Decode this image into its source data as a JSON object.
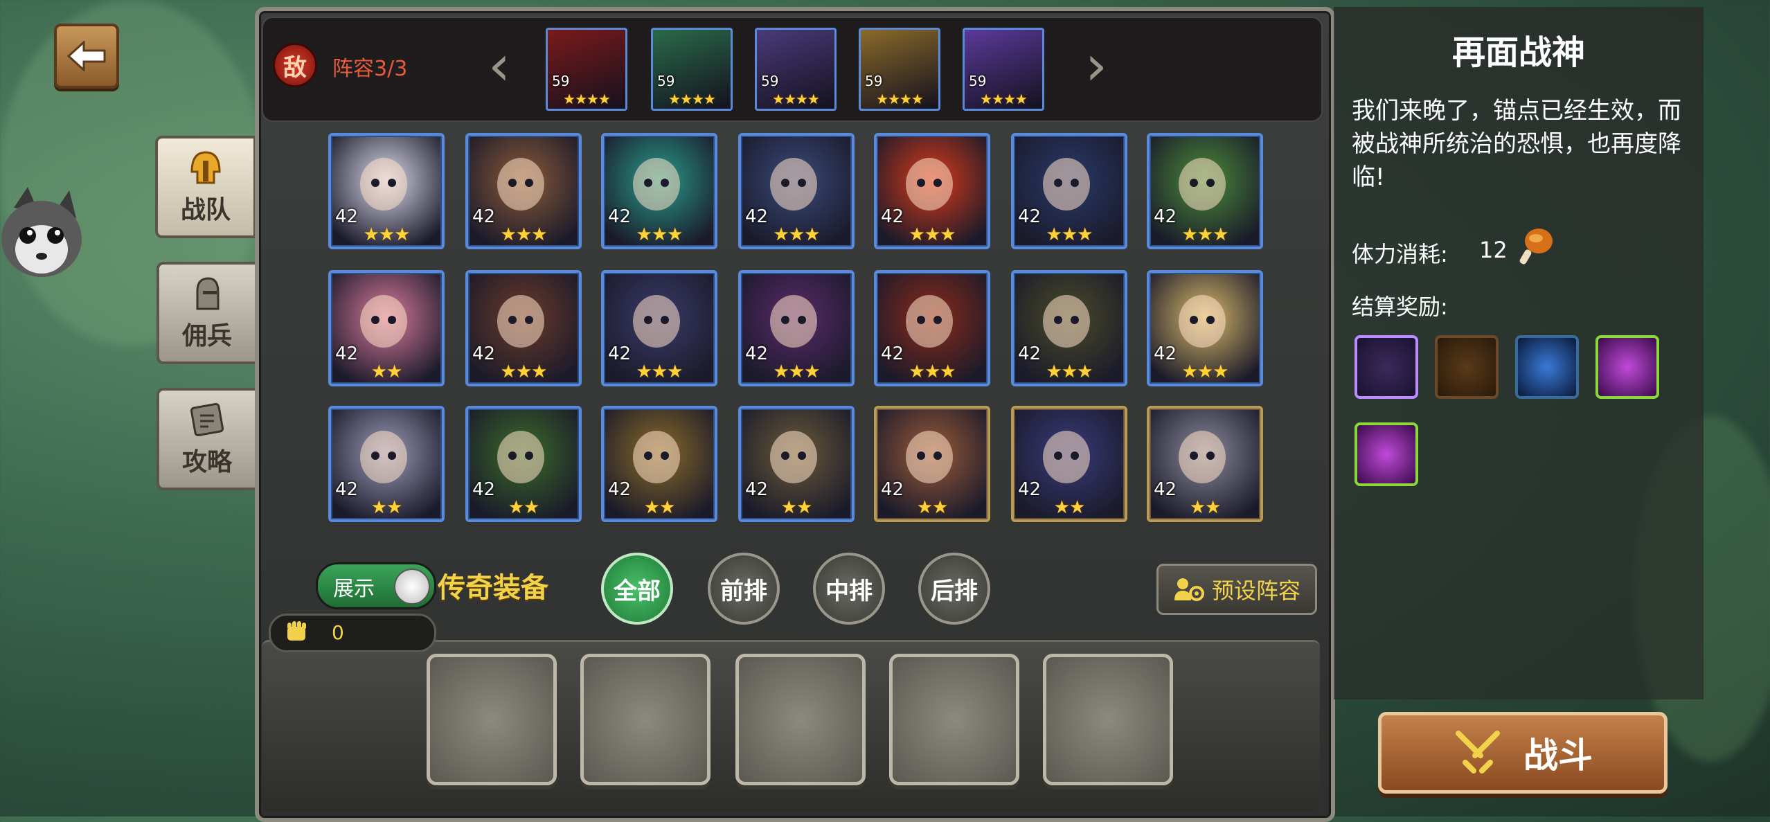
{
  "left": {
    "back_icon": "arrow-left-icon",
    "tabs": [
      {
        "label": "战队",
        "icon": "helmet-icon",
        "active": true
      },
      {
        "label": "佣兵",
        "icon": "knight-helmet-icon",
        "active": false
      },
      {
        "label": "攻略",
        "icon": "scroll-icon",
        "active": false
      }
    ]
  },
  "enemy": {
    "badge": "敌",
    "lineup_label": "阵容3/3",
    "heroes": [
      {
        "level": "59",
        "stars": "★★★★",
        "color": "#7a1a1a"
      },
      {
        "level": "59",
        "stars": "★★★★",
        "color": "#2a6a4a"
      },
      {
        "level": "59",
        "stars": "★★★★",
        "color": "#4a3a7a"
      },
      {
        "level": "59",
        "stars": "★★★★",
        "color": "#8a6a2a"
      },
      {
        "level": "59",
        "stars": "★★★★",
        "color": "#5a3a9a"
      }
    ]
  },
  "heroes": [
    {
      "level": "42",
      "stars": "★★★",
      "color": "#d8d8e8",
      "frame": "blue"
    },
    {
      "level": "42",
      "stars": "★★★",
      "color": "#8a5a3a",
      "frame": "blue"
    },
    {
      "level": "42",
      "stars": "★★★",
      "color": "#2a9a8a",
      "frame": "blue"
    },
    {
      "level": "42",
      "stars": "★★★",
      "color": "#3a4a7a",
      "frame": "blue"
    },
    {
      "level": "42",
      "stars": "★★★",
      "color": "#d83a1a",
      "frame": "blue"
    },
    {
      "level": "42",
      "stars": "★★★",
      "color": "#2a3a6a",
      "frame": "blue"
    },
    {
      "level": "42",
      "stars": "★★★",
      "color": "#4a8a3a",
      "frame": "blue"
    },
    {
      "level": "42",
      "stars": "★★",
      "color": "#d87a9a",
      "frame": "blue"
    },
    {
      "level": "42",
      "stars": "★★★",
      "color": "#6a3a2a",
      "frame": "blue"
    },
    {
      "level": "42",
      "stars": "★★★",
      "color": "#3a3a6a",
      "frame": "blue"
    },
    {
      "level": "42",
      "stars": "★★★",
      "color": "#5a2a6a",
      "frame": "blue"
    },
    {
      "level": "42",
      "stars": "★★★",
      "color": "#8a2a1a",
      "frame": "blue"
    },
    {
      "level": "42",
      "stars": "★★★",
      "color": "#4a4a2a",
      "frame": "blue"
    },
    {
      "level": "42",
      "stars": "★★★",
      "color": "#d8b86a",
      "frame": "blue"
    },
    {
      "level": "42",
      "stars": "★★",
      "color": "#9a9ab8",
      "frame": "blue"
    },
    {
      "level": "42",
      "stars": "★★",
      "color": "#3a6a2a",
      "frame": "blue"
    },
    {
      "level": "42",
      "stars": "★★",
      "color": "#8a6a2a",
      "frame": "blue"
    },
    {
      "level": "42",
      "stars": "★★",
      "color": "#6a5a3a",
      "frame": "blue"
    },
    {
      "level": "42",
      "stars": "★★",
      "color": "#9a5a3a",
      "frame": "gold"
    },
    {
      "level": "42",
      "stars": "★★",
      "color": "#3a3a7a",
      "frame": "gold"
    },
    {
      "level": "42",
      "stars": "★★",
      "color": "#8a8a9a",
      "frame": "gold"
    }
  ],
  "controls": {
    "toggle_label": "展示",
    "legend_equip": "传奇装备",
    "filters": [
      "全部",
      "前排",
      "中排",
      "后排"
    ],
    "preset_label": "预设阵容",
    "power_value": "0"
  },
  "stage": {
    "title": "再面战神",
    "description": "我们来晚了，锚点已经生效，而被战神所统治的恐惧，也再度降临!",
    "stamina_label": "体力消耗:",
    "stamina_value": "12",
    "rewards_label": "结算奖励:",
    "battle_label": "战斗"
  }
}
